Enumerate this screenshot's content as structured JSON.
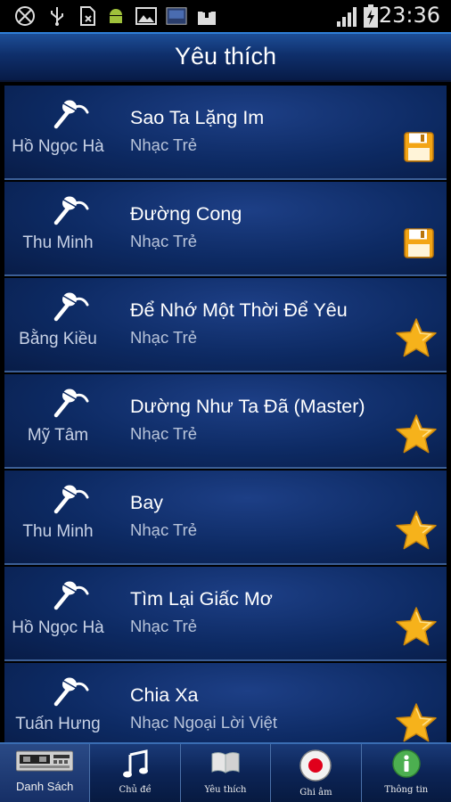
{
  "status": {
    "time": "23:36",
    "icons": [
      "gps-off-icon",
      "usb-icon",
      "sim-card-icon",
      "android-debug-icon",
      "image-icon",
      "screenshot-icon",
      "upload-icon",
      "signal-icon",
      "battery-charging-icon"
    ]
  },
  "header": {
    "title": "Yêu thích"
  },
  "songs": [
    {
      "artist": "Hồ Ngọc Hà",
      "title": "Sao Ta Lặng Im",
      "genre": "Nhạc Trẻ",
      "badge": "save"
    },
    {
      "artist": "Thu Minh",
      "title": "Đường Cong",
      "genre": "Nhạc Trẻ",
      "badge": "save"
    },
    {
      "artist": "Bằng Kiều",
      "title": "Để Nhớ Một Thời Để Yêu",
      "genre": "Nhạc Trẻ",
      "badge": "star"
    },
    {
      "artist": "Mỹ Tâm",
      "title": "Dường Như Ta Đã (Master)",
      "genre": "Nhạc Trẻ",
      "badge": "star"
    },
    {
      "artist": "Thu Minh",
      "title": "Bay",
      "genre": "Nhạc Trẻ",
      "badge": "star"
    },
    {
      "artist": "Hồ Ngọc Hà",
      "title": "Tìm Lại Giấc Mơ",
      "genre": "Nhạc Trẻ",
      "badge": "star"
    },
    {
      "artist": "Tuấn Hưng",
      "title": "Chia Xa",
      "genre": "Nhạc Ngoại Lời Việt",
      "badge": "star"
    }
  ],
  "tabs": [
    {
      "label": "Danh Sách",
      "icon": "cassette-deck-icon"
    },
    {
      "label": "Chủ đề",
      "icon": "music-note-icon"
    },
    {
      "label": "Yêu thích",
      "icon": "book-icon"
    },
    {
      "label": "Ghi âm",
      "icon": "record-icon"
    },
    {
      "label": "Thông tin",
      "icon": "info-icon"
    }
  ],
  "colors": {
    "accent": "#2f7fd8",
    "star": "#f6b21b",
    "save": "#f3a515",
    "record": "#e0001b",
    "info": "#4caf50"
  }
}
